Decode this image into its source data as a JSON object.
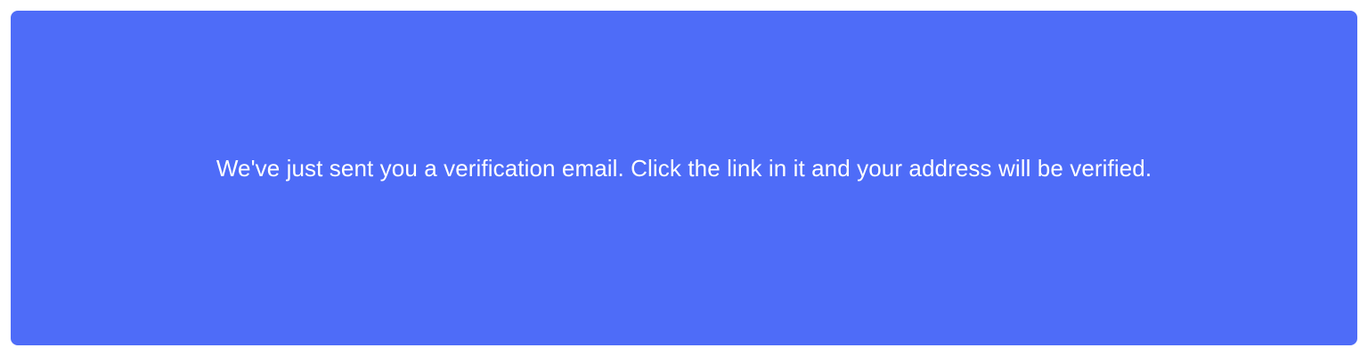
{
  "notice": {
    "message": "We've just sent you a verification email. Click the link in it and your address will be verified.",
    "background_color": "#4e6cf8",
    "text_color": "#ffffff"
  }
}
